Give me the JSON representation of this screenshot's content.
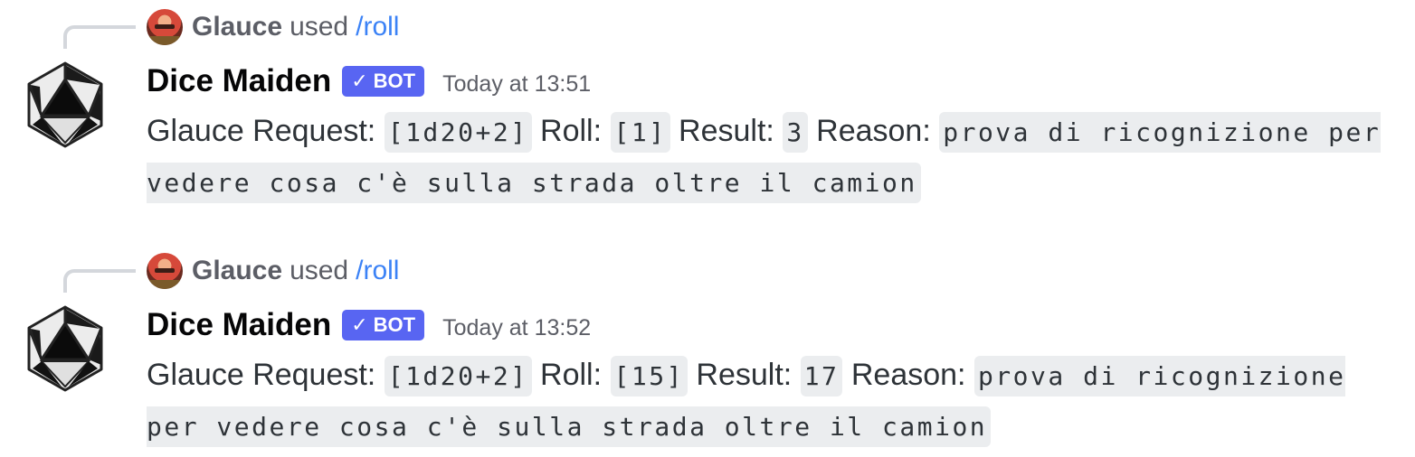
{
  "messages": [
    {
      "reply": {
        "user": "Glauce",
        "used": "used",
        "command": "/roll"
      },
      "author": "Dice Maiden",
      "bot_tag": {
        "check": "✓",
        "label": "BOT"
      },
      "timestamp": "Today at 13:51",
      "content": {
        "request_label": "Glauce Request:",
        "request": "[1d20+2]",
        "roll_label": "Roll:",
        "roll": "[1]",
        "result_label": "Result:",
        "result": "3",
        "reason_label": "Reason:",
        "reason": "prova di ricognizione per vedere cosa c'è sulla strada oltre il camion"
      }
    },
    {
      "reply": {
        "user": "Glauce",
        "used": "used",
        "command": "/roll"
      },
      "author": "Dice Maiden",
      "bot_tag": {
        "check": "✓",
        "label": "BOT"
      },
      "timestamp": "Today at 13:52",
      "content": {
        "request_label": "Glauce Request:",
        "request": "[1d20+2]",
        "roll_label": "Roll:",
        "roll": "[15]",
        "result_label": "Result:",
        "result": "17",
        "reason_label": "Reason:",
        "reason": "prova di ricognizione per vedere cosa c'è sulla strada oltre il camion"
      }
    }
  ],
  "colors": {
    "bot_tag": "#5865f2",
    "command_link": "#3b82f6",
    "code_bg": "#ebedef"
  },
  "icons": {
    "bot_avatar": "d20-dice-icon",
    "user_avatar": "glauce-avatar"
  }
}
